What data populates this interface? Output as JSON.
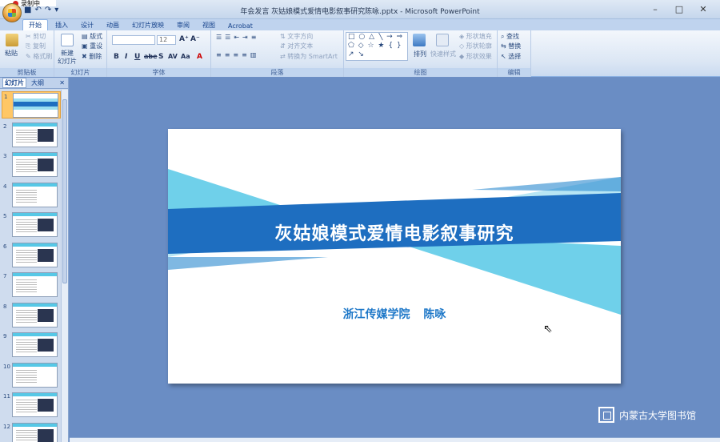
{
  "recording": {
    "label": "录制中"
  },
  "window": {
    "title": "年会发言 灰姑娘模式爱情电影叙事研究陈咏.pptx - Microsoft PowerPoint",
    "controls": [
      "–",
      "□",
      "✕"
    ]
  },
  "qat": {
    "save": "■",
    "undo": "↶",
    "redo": "↷",
    "more": "▾"
  },
  "tabs": [
    "开始",
    "插入",
    "设计",
    "动画",
    "幻灯片放映",
    "审阅",
    "视图",
    "Acrobat"
  ],
  "ribbon": {
    "clipboard": {
      "label": "剪贴板",
      "paste": "粘贴",
      "cut": "剪切",
      "copy": "复制",
      "format_painter": "格式刷"
    },
    "slides": {
      "label": "幻灯片",
      "new_slide": "新建",
      "new_slide2": "幻灯片",
      "layout": "版式",
      "reset": "重设",
      "delete": "删除"
    },
    "font": {
      "label": "字体",
      "font_name": "",
      "font_size": "12",
      "buttons": [
        "B",
        "I",
        "U",
        "abe",
        "S",
        "AV",
        "Aa",
        "A"
      ]
    },
    "paragraph": {
      "label": "段落",
      "text_direction": "文字方向",
      "align_text": "对齐文本",
      "smartart": "转换为 SmartArt"
    },
    "drawing": {
      "label": "绘图",
      "shapes": "□ ○ △ ╲ → ⇒ ⬠ ◇ ☆ ★ { } ↗ ↘",
      "arrange": "排列",
      "quick_styles": "快速样式",
      "fill": "形状填充",
      "outline": "形状轮廓",
      "effects": "形状效果"
    },
    "editing": {
      "label": "编辑",
      "find": "查找",
      "replace": "替换",
      "select": "选择"
    }
  },
  "leftpane": {
    "tab_slides": "幻灯片",
    "tab_outline": "大纲",
    "close": "✕",
    "slide_numbers": [
      "1",
      "2",
      "3",
      "4",
      "5",
      "6",
      "7",
      "8",
      "9",
      "10",
      "11",
      "12"
    ]
  },
  "slide": {
    "title": "灰姑娘模式爱情电影叙事研究",
    "subtitle": "浙江传媒学院 陈咏"
  },
  "watermark": {
    "text": "内蒙古大学图书馆"
  },
  "colors": {
    "band_dark": "#1e6ec0",
    "band_light": "#56c8e6",
    "subtitle": "#1e78c8",
    "stage": "#6a8dc4"
  }
}
